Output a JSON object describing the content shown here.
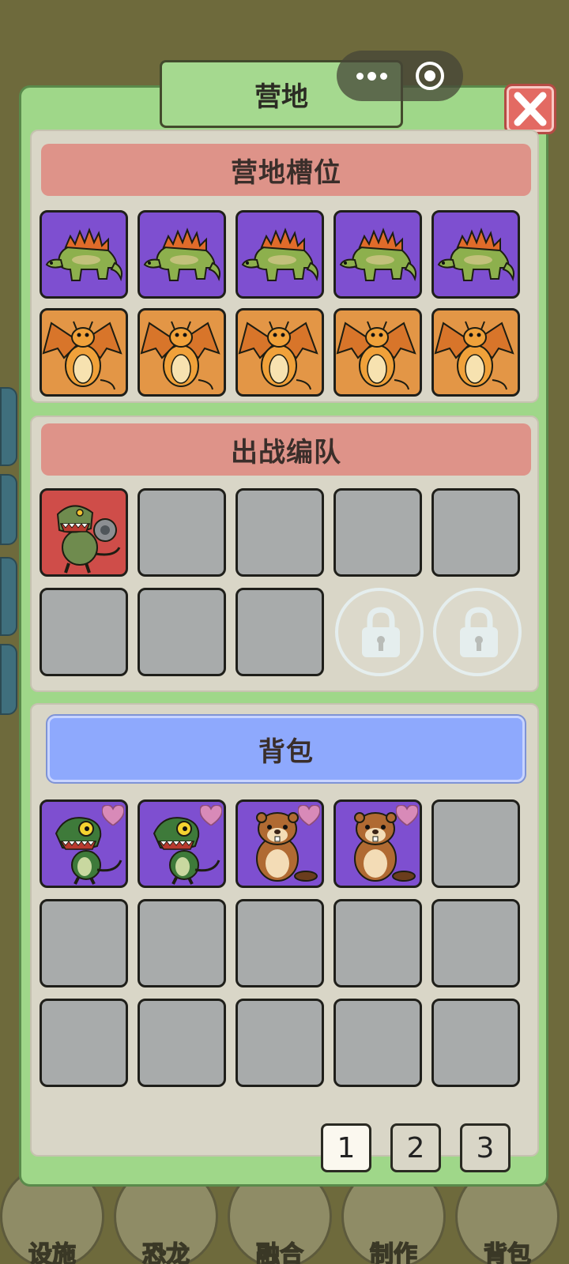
{
  "window": {
    "title": "营地"
  },
  "sections": {
    "camp_slots": {
      "title": "营地槽位"
    },
    "battle_team": {
      "title": "出战编队"
    },
    "backpack": {
      "title": "背包"
    }
  },
  "camp_slots": [
    {
      "creature": "stegosaurus",
      "rarity_color": "#7e4fd0"
    },
    {
      "creature": "stegosaurus",
      "rarity_color": "#7e4fd0"
    },
    {
      "creature": "stegosaurus",
      "rarity_color": "#7e4fd0"
    },
    {
      "creature": "stegosaurus",
      "rarity_color": "#7e4fd0"
    },
    {
      "creature": "stegosaurus",
      "rarity_color": "#7e4fd0"
    },
    {
      "creature": "orange-dragon",
      "rarity_color": "#e39646"
    },
    {
      "creature": "orange-dragon",
      "rarity_color": "#e39646"
    },
    {
      "creature": "orange-dragon",
      "rarity_color": "#e39646"
    },
    {
      "creature": "orange-dragon",
      "rarity_color": "#e39646"
    },
    {
      "creature": "orange-dragon",
      "rarity_color": "#e39646"
    }
  ],
  "battle_team": [
    {
      "creature": "mech-t-rex",
      "rarity_color": "#cf4d49"
    },
    {
      "creature": "empty"
    },
    {
      "creature": "empty"
    },
    {
      "creature": "empty"
    },
    {
      "creature": "empty"
    },
    {
      "creature": "empty"
    },
    {
      "creature": "empty"
    },
    {
      "creature": "empty"
    },
    {
      "creature": "locked"
    },
    {
      "creature": "locked"
    }
  ],
  "backpack": [
    {
      "creature": "green-raptor",
      "rarity_color": "#7e4fd0",
      "favorite": true
    },
    {
      "creature": "green-raptor",
      "rarity_color": "#7e4fd0",
      "favorite": true
    },
    {
      "creature": "beaver",
      "rarity_color": "#7e4fd0",
      "favorite": true
    },
    {
      "creature": "beaver",
      "rarity_color": "#7e4fd0",
      "favorite": true
    }
  ],
  "pagination": {
    "pages": [
      "1",
      "2",
      "3"
    ],
    "current": "1"
  },
  "bottom_nav": [
    "设施",
    "恐龙",
    "融合",
    "制作",
    "背包"
  ],
  "colors": {
    "panel": "#9fd789",
    "section": "#d9d6c7",
    "header_red": "#de9389",
    "header_blue": "#8ea9fd",
    "empty_slot": "#a8abab",
    "close": "#e36a63"
  }
}
